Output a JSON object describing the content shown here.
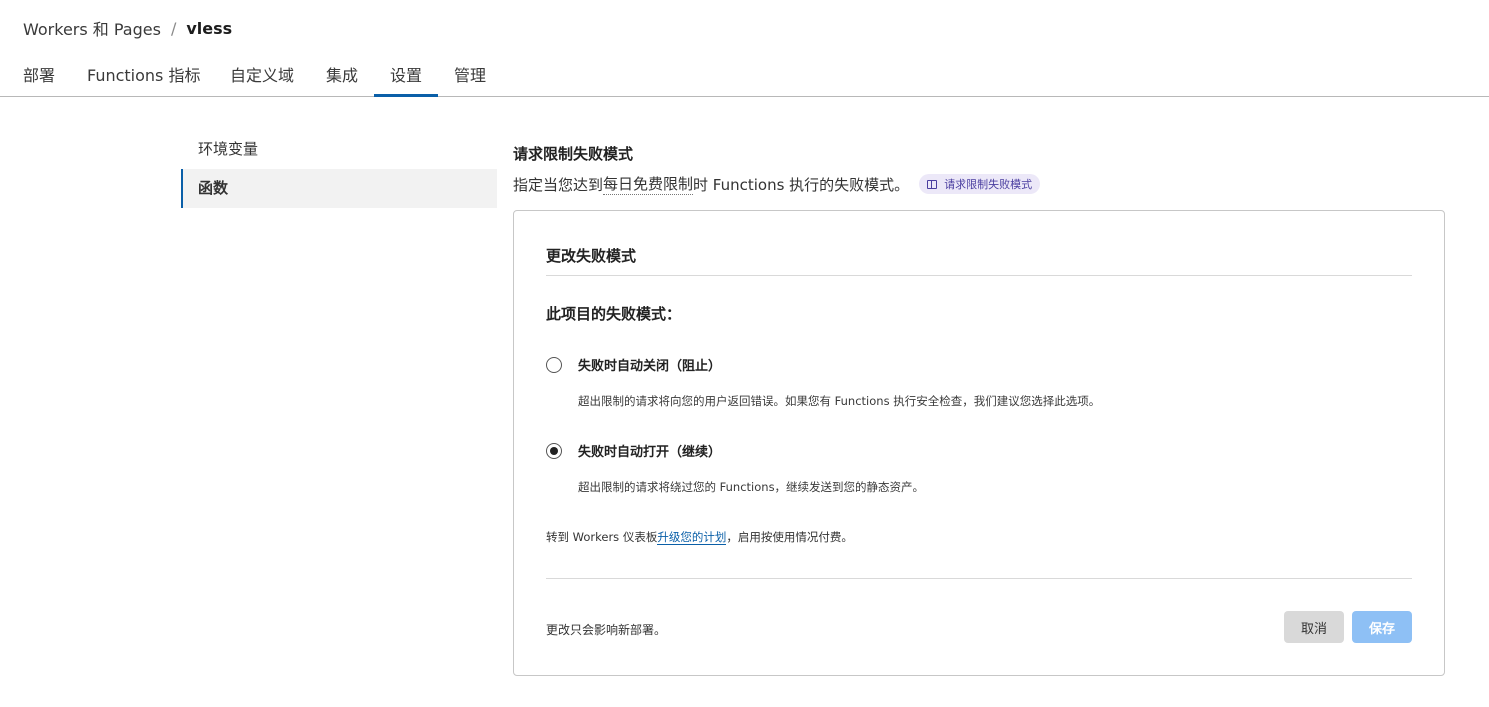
{
  "breadcrumb": {
    "parent": "Workers 和 Pages",
    "separator": "/",
    "current": "vless"
  },
  "tabs": [
    {
      "label": "部署"
    },
    {
      "label": "Functions 指标"
    },
    {
      "label": "自定义域"
    },
    {
      "label": "集成"
    },
    {
      "label": "设置"
    },
    {
      "label": "管理"
    }
  ],
  "active_tab": "设置",
  "sidenav": {
    "items": [
      {
        "label": "环境变量"
      },
      {
        "label": "函数"
      }
    ],
    "active": "函数"
  },
  "section": {
    "title": "请求限制失败模式",
    "desc_pre": "指定当您达到",
    "desc_link": "每日免费限制",
    "desc_post": "时 Functions 执行的失败模式。",
    "doc_pill": "请求限制失败模式"
  },
  "card": {
    "title": "更改失败模式",
    "subtitle": "此项目的失败模式：",
    "options": [
      {
        "label": "失败时自动关闭（阻止）",
        "help": "超出限制的请求将向您的用户返回错误。如果您有 Functions 执行安全检查，我们建议您选择此选项。",
        "checked": false
      },
      {
        "label": "失败时自动打开（继续）",
        "help": "超出限制的请求将绕过您的 Functions，继续发送到您的静态资产。",
        "checked": true
      }
    ],
    "note_pre": "转到 Workers 仪表板",
    "note_link": "升级您的计划",
    "note_post": "，启用按使用情况付费。",
    "footer_note": "更改只会影响新部署。",
    "cancel_label": "取消",
    "save_label": "保存"
  },
  "colors": {
    "accent": "#0a5fa8",
    "save_button": "#8ec0f5",
    "cancel_button": "#d9d9d9",
    "doc_pill_bg": "#ece8f8"
  }
}
